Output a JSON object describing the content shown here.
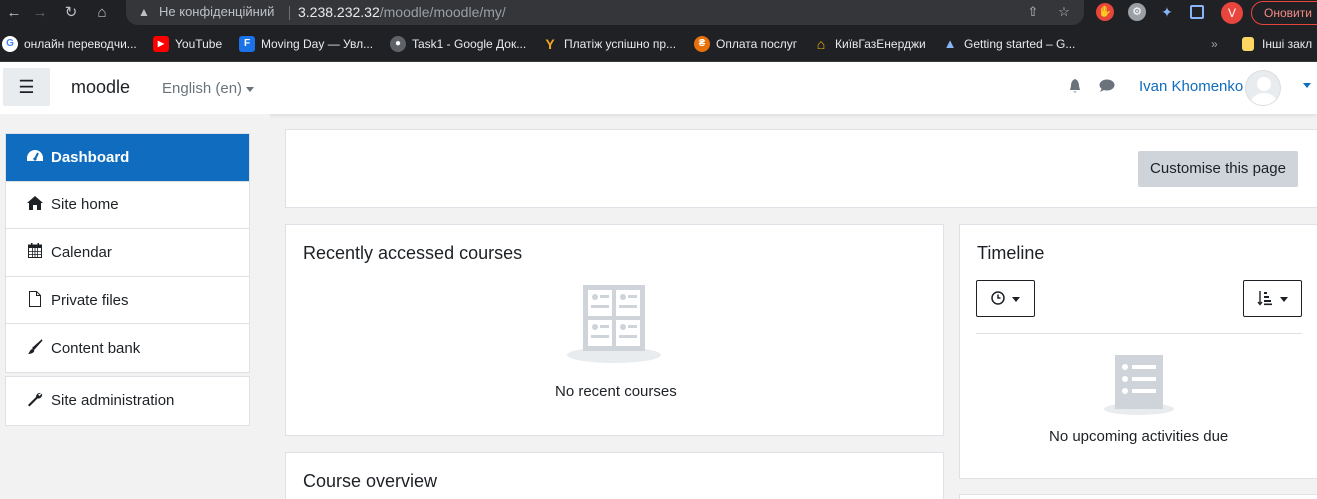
{
  "browser": {
    "not_secure_label": "Не конфіденційний",
    "url_host": "3.238.232.32",
    "url_path": "/moodle/moodle/my/",
    "profile_initial": "V",
    "update_label": "Оновити",
    "bookmarks": [
      {
        "label": "онлайн переводчи...",
        "icon": "google-icon",
        "color": "#ffffff"
      },
      {
        "label": "YouTube",
        "icon": "youtube-icon",
        "color": "#ff0000"
      },
      {
        "label": "Moving Day — Увл...",
        "icon": "f-logo-icon",
        "color": "#1a73e8"
      },
      {
        "label": "Task1 - Google Док...",
        "icon": "globe-icon",
        "color": "#5f6368"
      },
      {
        "label": "Платіж успішно пр...",
        "icon": "y-logo-icon",
        "color": "#f5a623"
      },
      {
        "label": "Оплата послуг",
        "icon": "payment-icon",
        "color": "#e8710a"
      },
      {
        "label": "КиївГазЕнерджи",
        "icon": "house-icon",
        "color": "#fbbc04"
      },
      {
        "label": "Getting started – G...",
        "icon": "graduation-cap-icon",
        "color": "#8ab4f8"
      }
    ],
    "other_bookmarks_label": "Інші закл"
  },
  "navbar": {
    "brand": "moodle",
    "language": "English (en)",
    "username": "Ivan Khomenko"
  },
  "drawer": {
    "items": [
      {
        "label": "Dashboard",
        "icon": "dashboard-icon",
        "active": true
      },
      {
        "label": "Site home",
        "icon": "home-icon",
        "active": false
      },
      {
        "label": "Calendar",
        "icon": "calendar-icon",
        "active": false
      },
      {
        "label": "Private files",
        "icon": "file-icon",
        "active": false
      },
      {
        "label": "Content bank",
        "icon": "paintbrush-icon",
        "active": false
      }
    ],
    "admin_item": {
      "label": "Site administration",
      "icon": "wrench-icon"
    }
  },
  "main": {
    "customise_label": "Customise this page",
    "recent": {
      "title": "Recently accessed courses",
      "empty_text": "No recent courses"
    },
    "timeline": {
      "title": "Timeline",
      "empty_text": "No upcoming activities due"
    },
    "overview": {
      "title": "Course overview"
    }
  },
  "colors": {
    "primary": "#0f6cbf",
    "chrome_bg": "#202124",
    "page_bg": "#f2f2f2"
  }
}
